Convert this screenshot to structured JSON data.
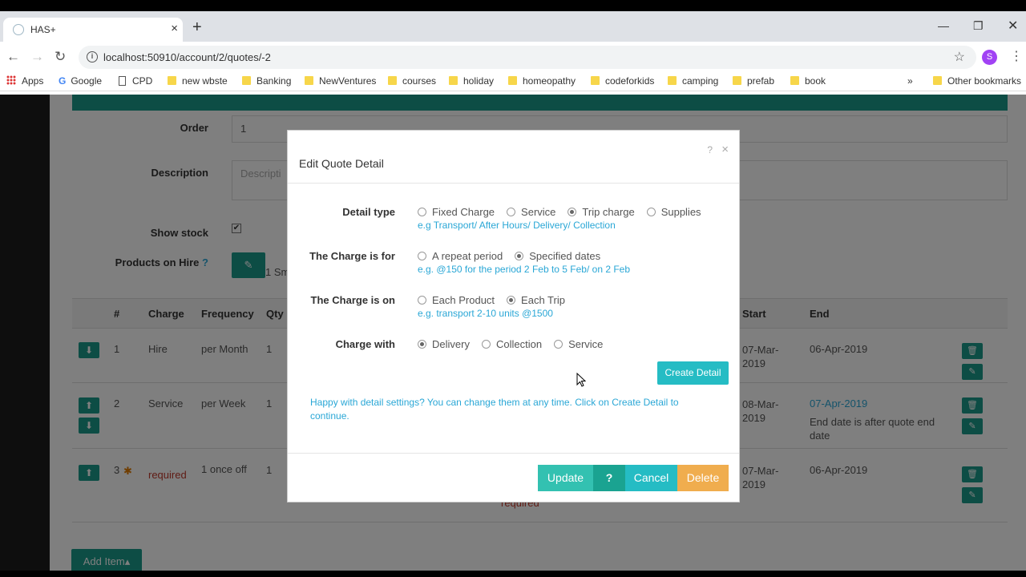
{
  "browser": {
    "tab_title": "HAS+",
    "url": "localhost:50910/account/2/quotes/-2",
    "profile_initial": "S",
    "bookmarks": [
      "Apps",
      "Google",
      "CPD",
      "new wbste",
      "Banking",
      "NewVentures",
      "courses",
      "holiday",
      "homeopathy",
      "codeforkids",
      "camping",
      "prefab",
      "book"
    ],
    "other_bookmarks": "Other bookmarks",
    "overflow": "»"
  },
  "form": {
    "order_label": "Order",
    "order_value": "1",
    "description_label": "Description",
    "description_placeholder": "Descripti",
    "show_stock_label": "Show stock",
    "show_stock_checked": "✔",
    "products_on_hire_label": "Products on Hire",
    "products_help": "?",
    "partial_text": "1 Sm"
  },
  "table": {
    "headers": [
      "#",
      "Charge",
      "Frequency",
      "Qty",
      "Start",
      "End"
    ],
    "rows": [
      {
        "num": "1",
        "charge": "Hire",
        "frequency": "per Month",
        "qty": "1",
        "start": "07-Mar-2019",
        "end": "06-Apr-2019",
        "end_note": ""
      },
      {
        "num": "2",
        "charge": "Service",
        "frequency": "per Week",
        "qty": "1",
        "start": "08-Mar-2019",
        "end": "07-Apr-2019",
        "end_note": "End date is after quote end date"
      },
      {
        "num": "3",
        "charge": "required",
        "frequency": "1 once off",
        "qty": "1",
        "start": "07-Mar-2019",
        "end": "06-Apr-2019",
        "end_note": ""
      }
    ],
    "row3_under": "required"
  },
  "add_item_label": "Add Item▴",
  "modal": {
    "title": "Edit Quote Detail",
    "help": "?",
    "close": "×",
    "detail_type": {
      "label": "Detail type",
      "options": [
        "Fixed Charge",
        "Service",
        "Trip charge",
        "Supplies"
      ],
      "selected": "Trip charge",
      "hint": "e.g Transport/ After Hours/ Delivery/ Collection"
    },
    "charge_for": {
      "label": "The Charge is for",
      "options": [
        "A repeat period",
        "Specified dates"
      ],
      "selected": "Specified dates",
      "hint": "e.g. @150 for the period 2 Feb to 5 Feb/ on 2 Feb"
    },
    "charge_on": {
      "label": "The Charge is on",
      "options": [
        "Each Product",
        "Each Trip"
      ],
      "selected": "Each Trip",
      "hint": "e.g. transport 2-10 units @1500"
    },
    "charge_with": {
      "label": "Charge with",
      "options": [
        "Delivery",
        "Collection",
        "Service"
      ],
      "selected": "Delivery"
    },
    "create_detail": "Create Detail",
    "happy_text": "Happy with detail settings? You can change them at any time. Click on Create Detail to continue.",
    "buttons": {
      "update": "Update",
      "help": "?",
      "cancel": "Cancel",
      "delete": "Delete"
    },
    "colors": {
      "update": "#33c1b1",
      "help": "#1aa391",
      "cancel": "#25bcc4",
      "delete": "#f0ad4e",
      "hint": "#2aa7d6"
    }
  }
}
